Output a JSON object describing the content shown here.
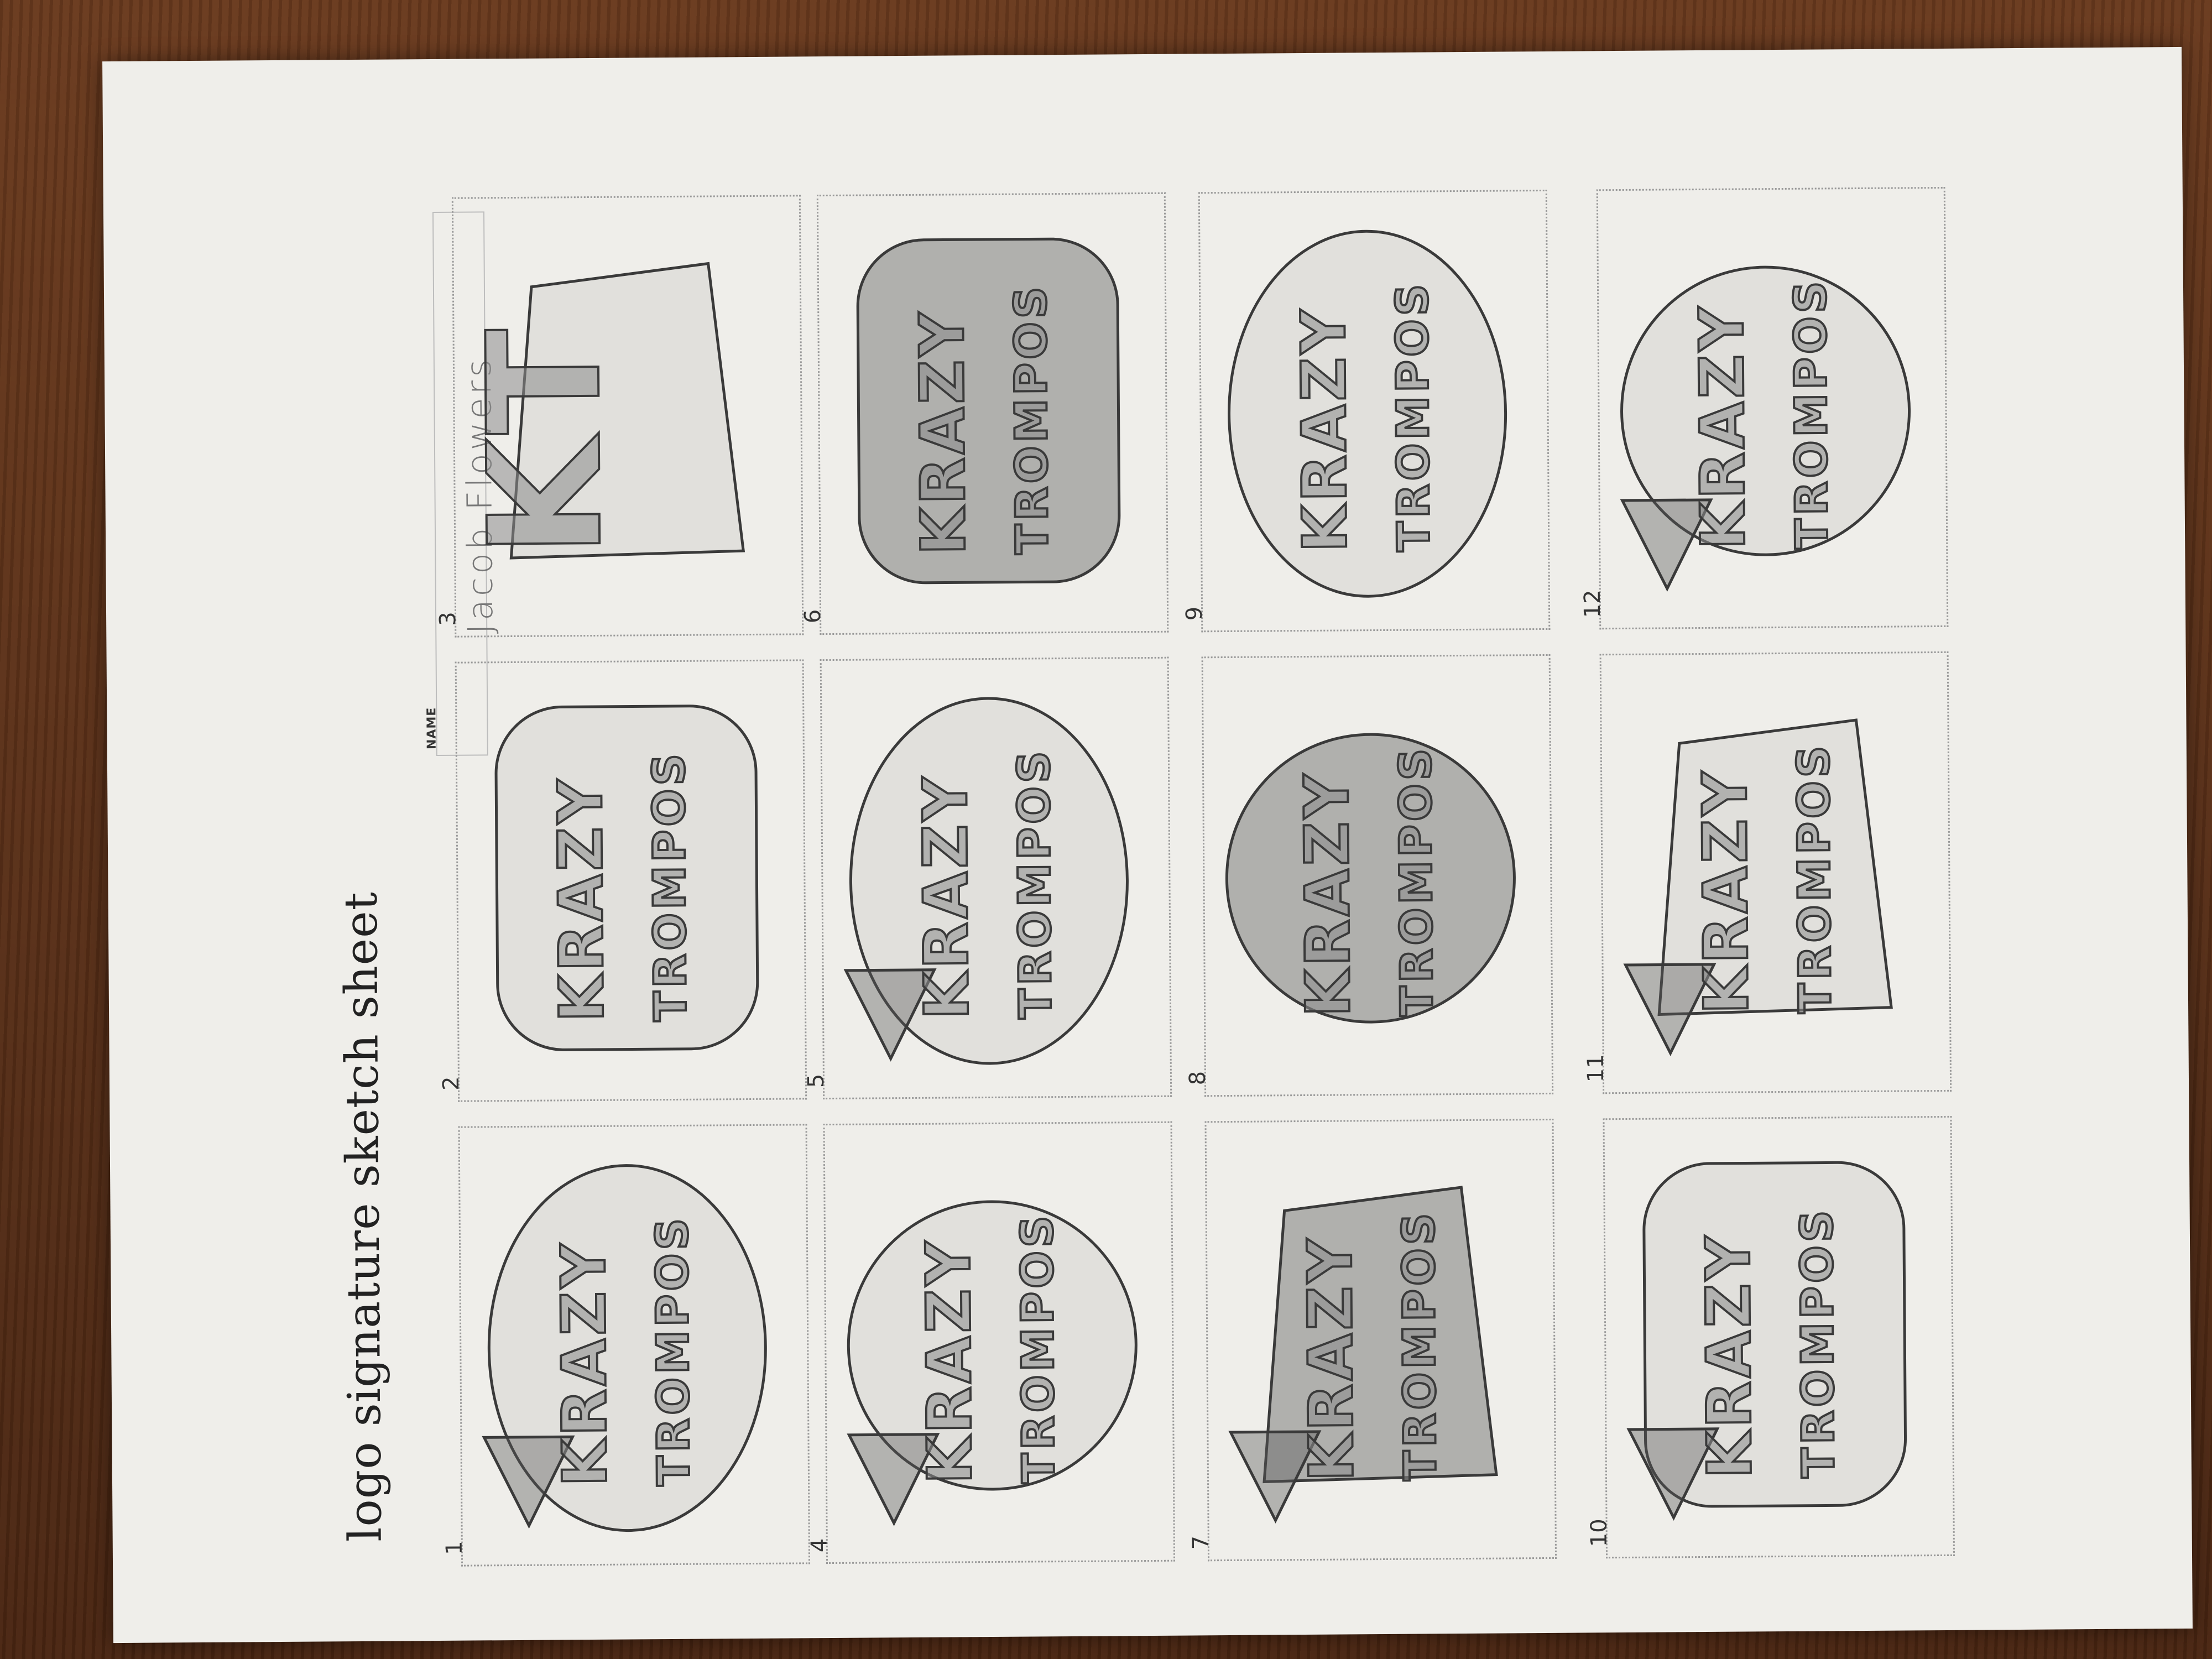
{
  "sheet": {
    "title": "logo signature sketch sheet",
    "name_label": "NAME",
    "name_value": "Jacob   Flowers"
  },
  "cells": [
    {
      "number": "1",
      "lines": [
        "KRAZY",
        "TROMPOS"
      ]
    },
    {
      "number": "2",
      "lines": [
        "KRAZY",
        "TROMPOS"
      ]
    },
    {
      "number": "3",
      "lines": [
        "KT"
      ]
    },
    {
      "number": "4",
      "lines": [
        "KRAZY",
        "TROMPOS"
      ]
    },
    {
      "number": "5",
      "lines": [
        "KRAZY",
        "TROMPOS"
      ]
    },
    {
      "number": "6",
      "lines": [
        "KRAZY",
        "TROMPOS"
      ]
    },
    {
      "number": "7",
      "lines": [
        "KRAZY",
        "TROMPOS"
      ]
    },
    {
      "number": "8",
      "lines": [
        "KRAZY",
        "TROMPOS"
      ]
    },
    {
      "number": "9",
      "lines": [
        "KRAZY",
        "TROMPOS"
      ]
    },
    {
      "number": "10",
      "lines": [
        "KRAZY",
        "TROMPOS"
      ]
    },
    {
      "number": "11",
      "lines": [
        "KRAZY",
        "TROMPOS"
      ]
    },
    {
      "number": "12",
      "lines": [
        "KRAZY",
        "TROMPOS"
      ]
    }
  ],
  "colors": {
    "paper": "#efeeea",
    "pencil": "#3a3a3a",
    "table": "#5a2f17"
  }
}
